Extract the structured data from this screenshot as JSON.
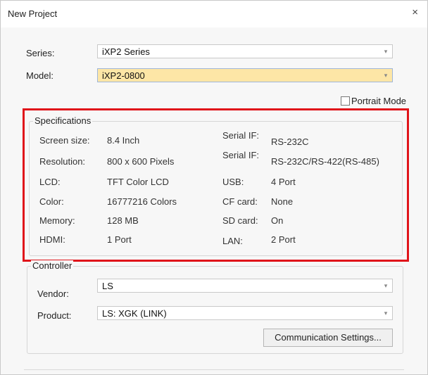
{
  "window": {
    "title": "New Project",
    "close": "×"
  },
  "series": {
    "label": "Series:",
    "value": "iXP2 Series"
  },
  "model": {
    "label": "Model:",
    "value": "iXP2-0800"
  },
  "portrait": {
    "label": "Portrait Mode",
    "checked": false
  },
  "specs": {
    "title": "Specifications",
    "left": [
      {
        "key": "Screen size:",
        "value": "8.4 Inch"
      },
      {
        "key": "Resolution:",
        "value": "800 x 600 Pixels"
      },
      {
        "key": "LCD:",
        "value": "TFT Color LCD"
      },
      {
        "key": "Color:",
        "value": "16777216 Colors"
      },
      {
        "key": "Memory:",
        "value": "128 MB"
      },
      {
        "key": "HDMI:",
        "value": "1 Port"
      }
    ],
    "right": [
      {
        "key": "Serial IF:",
        "value": "RS-232C"
      },
      {
        "key": "Serial IF:",
        "value": "RS-232C/RS-422(RS-485)"
      },
      {
        "key": "USB:",
        "value": "4 Port"
      },
      {
        "key": "CF card:",
        "value": "None"
      },
      {
        "key": "SD card:",
        "value": "On"
      },
      {
        "key": "LAN:",
        "value": "2 Port"
      }
    ]
  },
  "controller": {
    "title": "Controller",
    "vendor": {
      "label": "Vendor:",
      "value": "LS"
    },
    "product": {
      "label": "Product:",
      "value": "LS: XGK (LINK)"
    },
    "comm_button": "Communication Settings..."
  },
  "icons": {
    "dropdown": "chevron-down-icon",
    "close": "close-icon"
  },
  "colors": {
    "highlight": "#fde6a6",
    "annotation": "#e0141a"
  }
}
